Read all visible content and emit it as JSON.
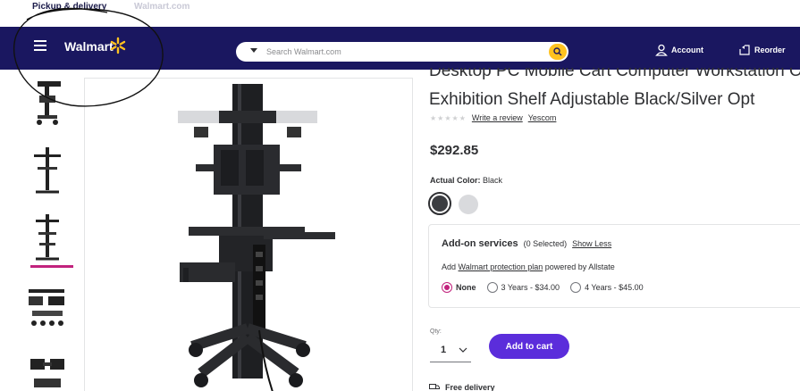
{
  "top_tabs": [
    {
      "label": "Pickup & delivery"
    },
    {
      "label": "Walmart.com"
    }
  ],
  "header": {
    "logo": "Walmart",
    "search_placeholder": "Search Walmart.com",
    "account_label": "Account",
    "reorder_label": "Reorder",
    "bg_color": "#1a1760",
    "spark_color": "#ffc220"
  },
  "product": {
    "title_line1": "Desktop PC Mobile Cart Computer Workstation Office",
    "title_line2": "Exhibition Shelf Adjustable Black/Silver Opt",
    "write_review": "Write a review",
    "brand": "Yescom",
    "price": "$292.85",
    "color_label": "Actual Color:",
    "color_value": "Black",
    "swatches": [
      "black-swatch",
      "silver-swatch"
    ]
  },
  "addon": {
    "title": "Add-on services",
    "selected": "(0 Selected)",
    "toggle": "Show Less",
    "sub_prefix": "Add",
    "sub_link": "Walmart protection plan",
    "sub_suffix": "powered by Allstate",
    "options": [
      {
        "label": "None",
        "selected": true
      },
      {
        "label": "3 Years - $34.00",
        "selected": false
      },
      {
        "label": "4 Years - $45.00",
        "selected": false
      }
    ]
  },
  "purchase": {
    "qty_label": "Qty:",
    "qty_value": "1",
    "add_to_cart": "Add to cart",
    "delivery": "Free delivery",
    "accent_color": "#5b2ddb"
  }
}
